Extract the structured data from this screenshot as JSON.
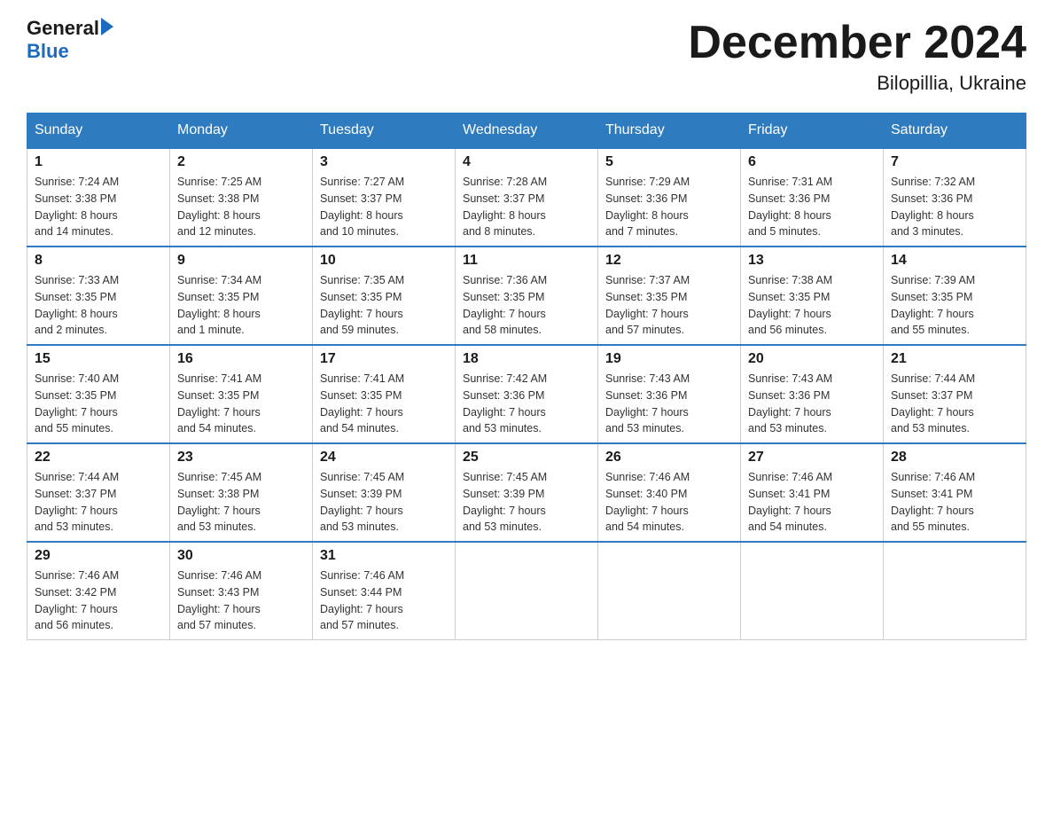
{
  "header": {
    "logo_general": "General",
    "logo_blue": "Blue",
    "month_title": "December 2024",
    "location": "Bilopillia, Ukraine"
  },
  "days_of_week": [
    "Sunday",
    "Monday",
    "Tuesday",
    "Wednesday",
    "Thursday",
    "Friday",
    "Saturday"
  ],
  "weeks": [
    [
      {
        "day": "1",
        "sunrise": "7:24 AM",
        "sunset": "3:38 PM",
        "daylight": "8 hours and 14 minutes."
      },
      {
        "day": "2",
        "sunrise": "7:25 AM",
        "sunset": "3:38 PM",
        "daylight": "8 hours and 12 minutes."
      },
      {
        "day": "3",
        "sunrise": "7:27 AM",
        "sunset": "3:37 PM",
        "daylight": "8 hours and 10 minutes."
      },
      {
        "day": "4",
        "sunrise": "7:28 AM",
        "sunset": "3:37 PM",
        "daylight": "8 hours and 8 minutes."
      },
      {
        "day": "5",
        "sunrise": "7:29 AM",
        "sunset": "3:36 PM",
        "daylight": "8 hours and 7 minutes."
      },
      {
        "day": "6",
        "sunrise": "7:31 AM",
        "sunset": "3:36 PM",
        "daylight": "8 hours and 5 minutes."
      },
      {
        "day": "7",
        "sunrise": "7:32 AM",
        "sunset": "3:36 PM",
        "daylight": "8 hours and 3 minutes."
      }
    ],
    [
      {
        "day": "8",
        "sunrise": "7:33 AM",
        "sunset": "3:35 PM",
        "daylight": "8 hours and 2 minutes."
      },
      {
        "day": "9",
        "sunrise": "7:34 AM",
        "sunset": "3:35 PM",
        "daylight": "8 hours and 1 minute."
      },
      {
        "day": "10",
        "sunrise": "7:35 AM",
        "sunset": "3:35 PM",
        "daylight": "7 hours and 59 minutes."
      },
      {
        "day": "11",
        "sunrise": "7:36 AM",
        "sunset": "3:35 PM",
        "daylight": "7 hours and 58 minutes."
      },
      {
        "day": "12",
        "sunrise": "7:37 AM",
        "sunset": "3:35 PM",
        "daylight": "7 hours and 57 minutes."
      },
      {
        "day": "13",
        "sunrise": "7:38 AM",
        "sunset": "3:35 PM",
        "daylight": "7 hours and 56 minutes."
      },
      {
        "day": "14",
        "sunrise": "7:39 AM",
        "sunset": "3:35 PM",
        "daylight": "7 hours and 55 minutes."
      }
    ],
    [
      {
        "day": "15",
        "sunrise": "7:40 AM",
        "sunset": "3:35 PM",
        "daylight": "7 hours and 55 minutes."
      },
      {
        "day": "16",
        "sunrise": "7:41 AM",
        "sunset": "3:35 PM",
        "daylight": "7 hours and 54 minutes."
      },
      {
        "day": "17",
        "sunrise": "7:41 AM",
        "sunset": "3:35 PM",
        "daylight": "7 hours and 54 minutes."
      },
      {
        "day": "18",
        "sunrise": "7:42 AM",
        "sunset": "3:36 PM",
        "daylight": "7 hours and 53 minutes."
      },
      {
        "day": "19",
        "sunrise": "7:43 AM",
        "sunset": "3:36 PM",
        "daylight": "7 hours and 53 minutes."
      },
      {
        "day": "20",
        "sunrise": "7:43 AM",
        "sunset": "3:36 PM",
        "daylight": "7 hours and 53 minutes."
      },
      {
        "day": "21",
        "sunrise": "7:44 AM",
        "sunset": "3:37 PM",
        "daylight": "7 hours and 53 minutes."
      }
    ],
    [
      {
        "day": "22",
        "sunrise": "7:44 AM",
        "sunset": "3:37 PM",
        "daylight": "7 hours and 53 minutes."
      },
      {
        "day": "23",
        "sunrise": "7:45 AM",
        "sunset": "3:38 PM",
        "daylight": "7 hours and 53 minutes."
      },
      {
        "day": "24",
        "sunrise": "7:45 AM",
        "sunset": "3:39 PM",
        "daylight": "7 hours and 53 minutes."
      },
      {
        "day": "25",
        "sunrise": "7:45 AM",
        "sunset": "3:39 PM",
        "daylight": "7 hours and 53 minutes."
      },
      {
        "day": "26",
        "sunrise": "7:46 AM",
        "sunset": "3:40 PM",
        "daylight": "7 hours and 54 minutes."
      },
      {
        "day": "27",
        "sunrise": "7:46 AM",
        "sunset": "3:41 PM",
        "daylight": "7 hours and 54 minutes."
      },
      {
        "day": "28",
        "sunrise": "7:46 AM",
        "sunset": "3:41 PM",
        "daylight": "7 hours and 55 minutes."
      }
    ],
    [
      {
        "day": "29",
        "sunrise": "7:46 AM",
        "sunset": "3:42 PM",
        "daylight": "7 hours and 56 minutes."
      },
      {
        "day": "30",
        "sunrise": "7:46 AM",
        "sunset": "3:43 PM",
        "daylight": "7 hours and 57 minutes."
      },
      {
        "day": "31",
        "sunrise": "7:46 AM",
        "sunset": "3:44 PM",
        "daylight": "7 hours and 57 minutes."
      },
      null,
      null,
      null,
      null
    ]
  ],
  "labels": {
    "sunrise": "Sunrise:",
    "sunset": "Sunset:",
    "daylight": "Daylight:"
  }
}
